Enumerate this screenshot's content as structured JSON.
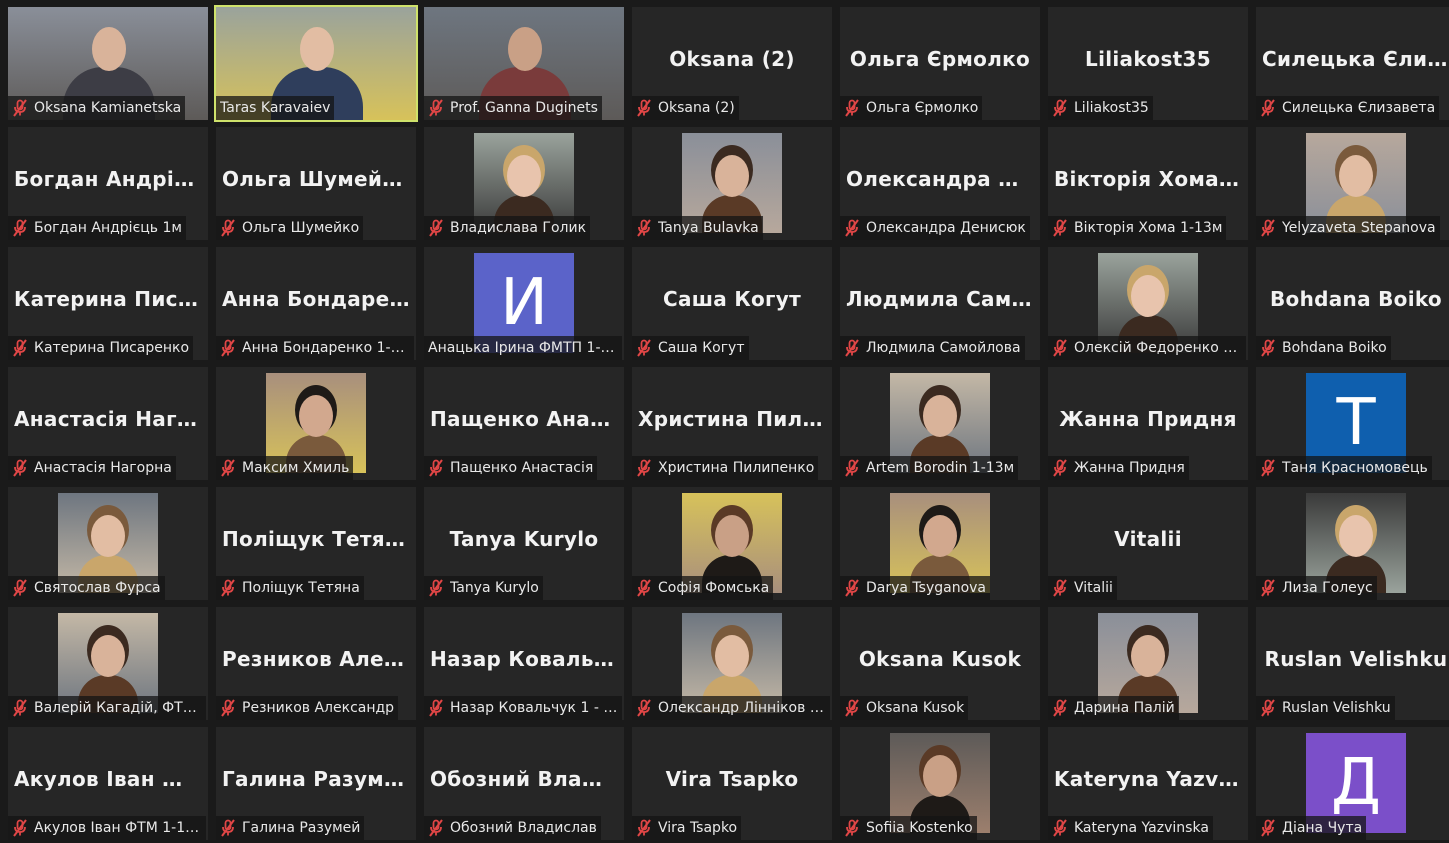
{
  "colors": {
    "active_border": "#cfe26b",
    "mic_muted": "#e04646"
  },
  "tiles": [
    {
      "name": "Oksana Kamianetska",
      "kind": "video",
      "muted": true
    },
    {
      "name": "Taras Karavaiev",
      "kind": "video",
      "muted": false,
      "active": true
    },
    {
      "name": "Prof. Ganna Duginets",
      "kind": "video",
      "muted": true
    },
    {
      "big": "Oksana (2)",
      "name": "Oksana (2)",
      "muted": true
    },
    {
      "big": "Ольга Єрмолко",
      "name": "Ольга Єрмолко",
      "muted": true
    },
    {
      "big": "Liliakost35",
      "name": "Liliakost35",
      "muted": true
    },
    {
      "big": "Силецька Єлиз...",
      "name": "Силецька Єлизавета",
      "muted": true
    },
    {
      "big": "Богдан Андріє...",
      "name": "Богдан Андрієць 1м",
      "muted": true
    },
    {
      "big": "Ольга Шумейко",
      "name": "Ольга Шумейко",
      "muted": true
    },
    {
      "name": "Владислава Голик",
      "kind": "thumb",
      "muted": true
    },
    {
      "name": "Tanya Bulavka",
      "kind": "thumb",
      "muted": true
    },
    {
      "big": "Олександра Де...",
      "name": "Олександра Денисюк",
      "muted": true
    },
    {
      "big": "Вікторія Хома...",
      "name": "Вікторія Хома 1-13м",
      "muted": true
    },
    {
      "name": "Yelyzaveta Stepanova",
      "kind": "thumb",
      "muted": true
    },
    {
      "big": "Катерина Писа...",
      "name": "Катерина Писаренко",
      "muted": true
    },
    {
      "big": "Анна Бондарен...",
      "name": "Анна Бондаренко 1-1...",
      "muted": true
    },
    {
      "name": "Анацька Ірина ФМТП 1-1...",
      "kind": "letter",
      "letter": "И",
      "letter_color": "#5b63c9",
      "muted": false
    },
    {
      "big": "Саша Когут",
      "name": "Саша Когут",
      "muted": true
    },
    {
      "big": "Людмила Само...",
      "name": "Людмила Самойлова",
      "muted": true
    },
    {
      "name": "Олексій Федоренко 1...",
      "kind": "thumb",
      "muted": true
    },
    {
      "big": "Bohdana Boiko",
      "name": "Bohdana Boiko",
      "muted": true
    },
    {
      "big": "Анастасія Наго...",
      "name": "Анастасія Нагорна",
      "muted": true
    },
    {
      "name": "Максим Хмиль",
      "kind": "thumb",
      "muted": true
    },
    {
      "big": "Пащенко Анаст...",
      "name": "Пащенко Анастасія",
      "muted": true
    },
    {
      "big": "Христина Пили...",
      "name": "Христина Пилипенко",
      "muted": true
    },
    {
      "name": "Artem Borodin 1-13м",
      "kind": "thumb",
      "muted": true
    },
    {
      "big": "Жанна Придня",
      "name": "Жанна Придня",
      "muted": true
    },
    {
      "name": "Таня Красномовець",
      "kind": "letter",
      "letter": "Т",
      "letter_color": "#0f5fae",
      "muted": true
    },
    {
      "name": "Святослав Фурса",
      "kind": "thumb",
      "muted": true
    },
    {
      "big": "Поліщук Тетяна",
      "name": "Поліщук Тетяна",
      "muted": true
    },
    {
      "big": "Tanya Kurylo",
      "name": "Tanya Kurylo",
      "muted": true
    },
    {
      "name": "Софія Фомська",
      "kind": "thumb",
      "muted": true
    },
    {
      "name": "Darya Tsyganova",
      "kind": "thumb",
      "muted": true
    },
    {
      "big": "Vitalii",
      "name": "Vitalii",
      "muted": true
    },
    {
      "name": "Лиза Голеус",
      "kind": "thumb",
      "muted": true
    },
    {
      "name": "Валерій Кагадій, ФТМ ...",
      "kind": "thumb",
      "muted": true
    },
    {
      "big": "Резников Алек...",
      "name": "Резников Александр",
      "muted": true
    },
    {
      "big": "Назар Ковальч...",
      "name": "Назар Ковальчук 1 - 1...",
      "muted": true
    },
    {
      "name": "Олександр Лінніков 1...",
      "kind": "thumb",
      "muted": true
    },
    {
      "big": "Oksana Kusok",
      "name": "Oksana Kusok",
      "muted": true
    },
    {
      "name": "Дарина Палій",
      "kind": "thumb",
      "muted": true
    },
    {
      "big": "Ruslan Velishku",
      "name": "Ruslan Velishku",
      "muted": true
    },
    {
      "big": "Акулов Іван ФТ...",
      "name": "Акулов Іван ФТМ 1-13...",
      "muted": true
    },
    {
      "big": "Галина Разумей",
      "name": "Галина Разумей",
      "muted": true
    },
    {
      "big": "Обозний Влад...",
      "name": "Обозний Владислав",
      "muted": true
    },
    {
      "big": "Vira Tsapko",
      "name": "Vira Tsapko",
      "muted": true
    },
    {
      "name": "Sofiia Kostenko",
      "kind": "thumb",
      "muted": true
    },
    {
      "big": "Kateryna Yazvin...",
      "name": "Kateryna Yazvinska",
      "muted": true
    },
    {
      "name": "Діана Чута",
      "kind": "letter",
      "letter": "Д",
      "letter_color": "#7b4fc9",
      "muted": true
    }
  ]
}
